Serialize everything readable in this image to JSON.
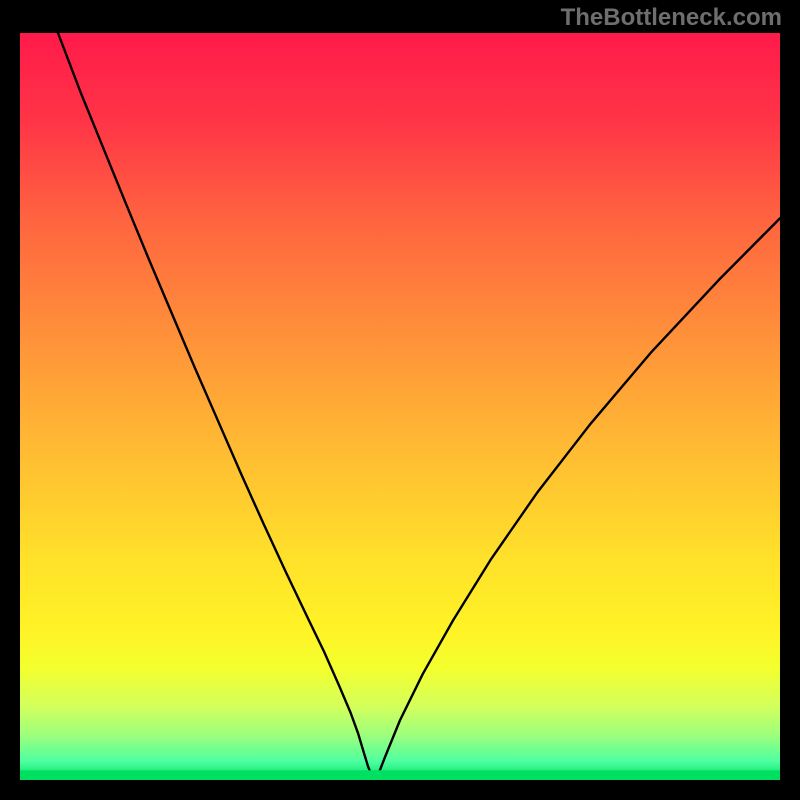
{
  "watermark": "TheBottleneck.com",
  "colors": {
    "curve_stroke": "#000000",
    "marker_fill": "#c86464",
    "marker_stroke": "#000000",
    "green_strip": "#00e060"
  },
  "chart_data": {
    "type": "line",
    "title": "",
    "xlabel": "",
    "ylabel": "",
    "xlim": [
      0,
      100
    ],
    "ylim": [
      0,
      100
    ],
    "gradient_stops": [
      {
        "offset": 0.0,
        "color": "#ff1a4a"
      },
      {
        "offset": 0.12,
        "color": "#ff3546"
      },
      {
        "offset": 0.25,
        "color": "#ff6440"
      },
      {
        "offset": 0.4,
        "color": "#ff8f3a"
      },
      {
        "offset": 0.55,
        "color": "#ffb933"
      },
      {
        "offset": 0.7,
        "color": "#ffe02a"
      },
      {
        "offset": 0.8,
        "color": "#fff326"
      },
      {
        "offset": 0.85,
        "color": "#f4ff2e"
      },
      {
        "offset": 0.9,
        "color": "#d4ff5a"
      },
      {
        "offset": 0.94,
        "color": "#9dff7d"
      },
      {
        "offset": 0.975,
        "color": "#4dffa0"
      },
      {
        "offset": 1.0,
        "color": "#00e060"
      }
    ],
    "series": [
      {
        "name": "bottleneck_curve",
        "x": [
          5,
          8,
          11,
          14,
          17,
          20,
          23,
          26,
          29,
          32,
          35,
          38,
          40,
          42,
          43.5,
          44.5,
          45.2,
          45.8,
          46.2,
          46.5,
          47,
          48,
          50,
          53,
          57,
          62,
          68,
          75,
          83,
          92,
          100
        ],
        "y": [
          100,
          92,
          84.5,
          77,
          69.6,
          62.4,
          55.2,
          48.2,
          41.2,
          34.4,
          27.8,
          21.4,
          17.2,
          12.6,
          9.0,
          6.2,
          3.8,
          1.8,
          0.8,
          0.0,
          0.4,
          3.0,
          8.0,
          14.2,
          21.4,
          29.6,
          38.4,
          47.6,
          57.2,
          67.0,
          75.2
        ]
      }
    ],
    "marker": {
      "x": 46.5,
      "y": 0.3,
      "rx_pct": 1.1,
      "ry_pct": 0.8
    },
    "green_strip_y": 0.0,
    "green_strip_height_pct": 1.3
  }
}
